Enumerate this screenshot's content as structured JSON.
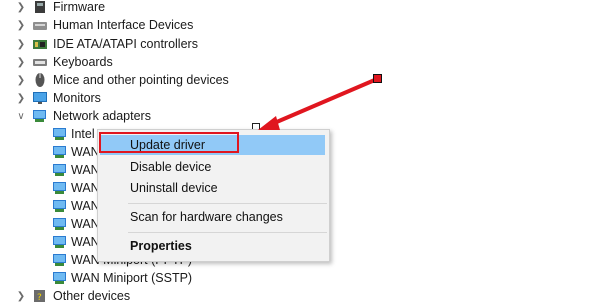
{
  "tree": {
    "items": [
      {
        "label": "Firmware",
        "icon": "firmware-icon",
        "state": "collapsed"
      },
      {
        "label": "Human Interface Devices",
        "icon": "hid-icon",
        "state": "collapsed"
      },
      {
        "label": "IDE ATA/ATAPI controllers",
        "icon": "ide-controller-icon",
        "state": "collapsed"
      },
      {
        "label": "Keyboards",
        "icon": "keyboard-icon",
        "state": "collapsed"
      },
      {
        "label": "Mice and other pointing devices",
        "icon": "mouse-icon",
        "state": "collapsed"
      },
      {
        "label": "Monitors",
        "icon": "monitor-icon",
        "state": "collapsed"
      },
      {
        "label": "Network adapters",
        "icon": "network-adapter-icon",
        "state": "expanded"
      }
    ],
    "network_children": [
      {
        "label": "Intel",
        "icon": "network-adapter-icon"
      },
      {
        "label": "WAN",
        "icon": "network-adapter-icon"
      },
      {
        "label": "WAN",
        "icon": "network-adapter-icon"
      },
      {
        "label": "WAN",
        "icon": "network-adapter-icon"
      },
      {
        "label": "WAN",
        "icon": "network-adapter-icon"
      },
      {
        "label": "WAN",
        "icon": "network-adapter-icon"
      },
      {
        "label": "WAN",
        "icon": "network-adapter-icon"
      },
      {
        "label": "WAN Miniport (PPTP)",
        "icon": "network-adapter-icon"
      },
      {
        "label": "WAN Miniport (SSTP)",
        "icon": "network-adapter-icon"
      }
    ],
    "after": [
      {
        "label": "Other devices",
        "icon": "other-devices-icon",
        "state": "collapsed"
      }
    ]
  },
  "context_menu": {
    "update_driver": "Update driver",
    "disable_device": "Disable device",
    "uninstall_device": "Uninstall device",
    "scan_changes": "Scan for hardware changes",
    "properties": "Properties"
  },
  "annotation": {
    "color": "#e0161f"
  }
}
